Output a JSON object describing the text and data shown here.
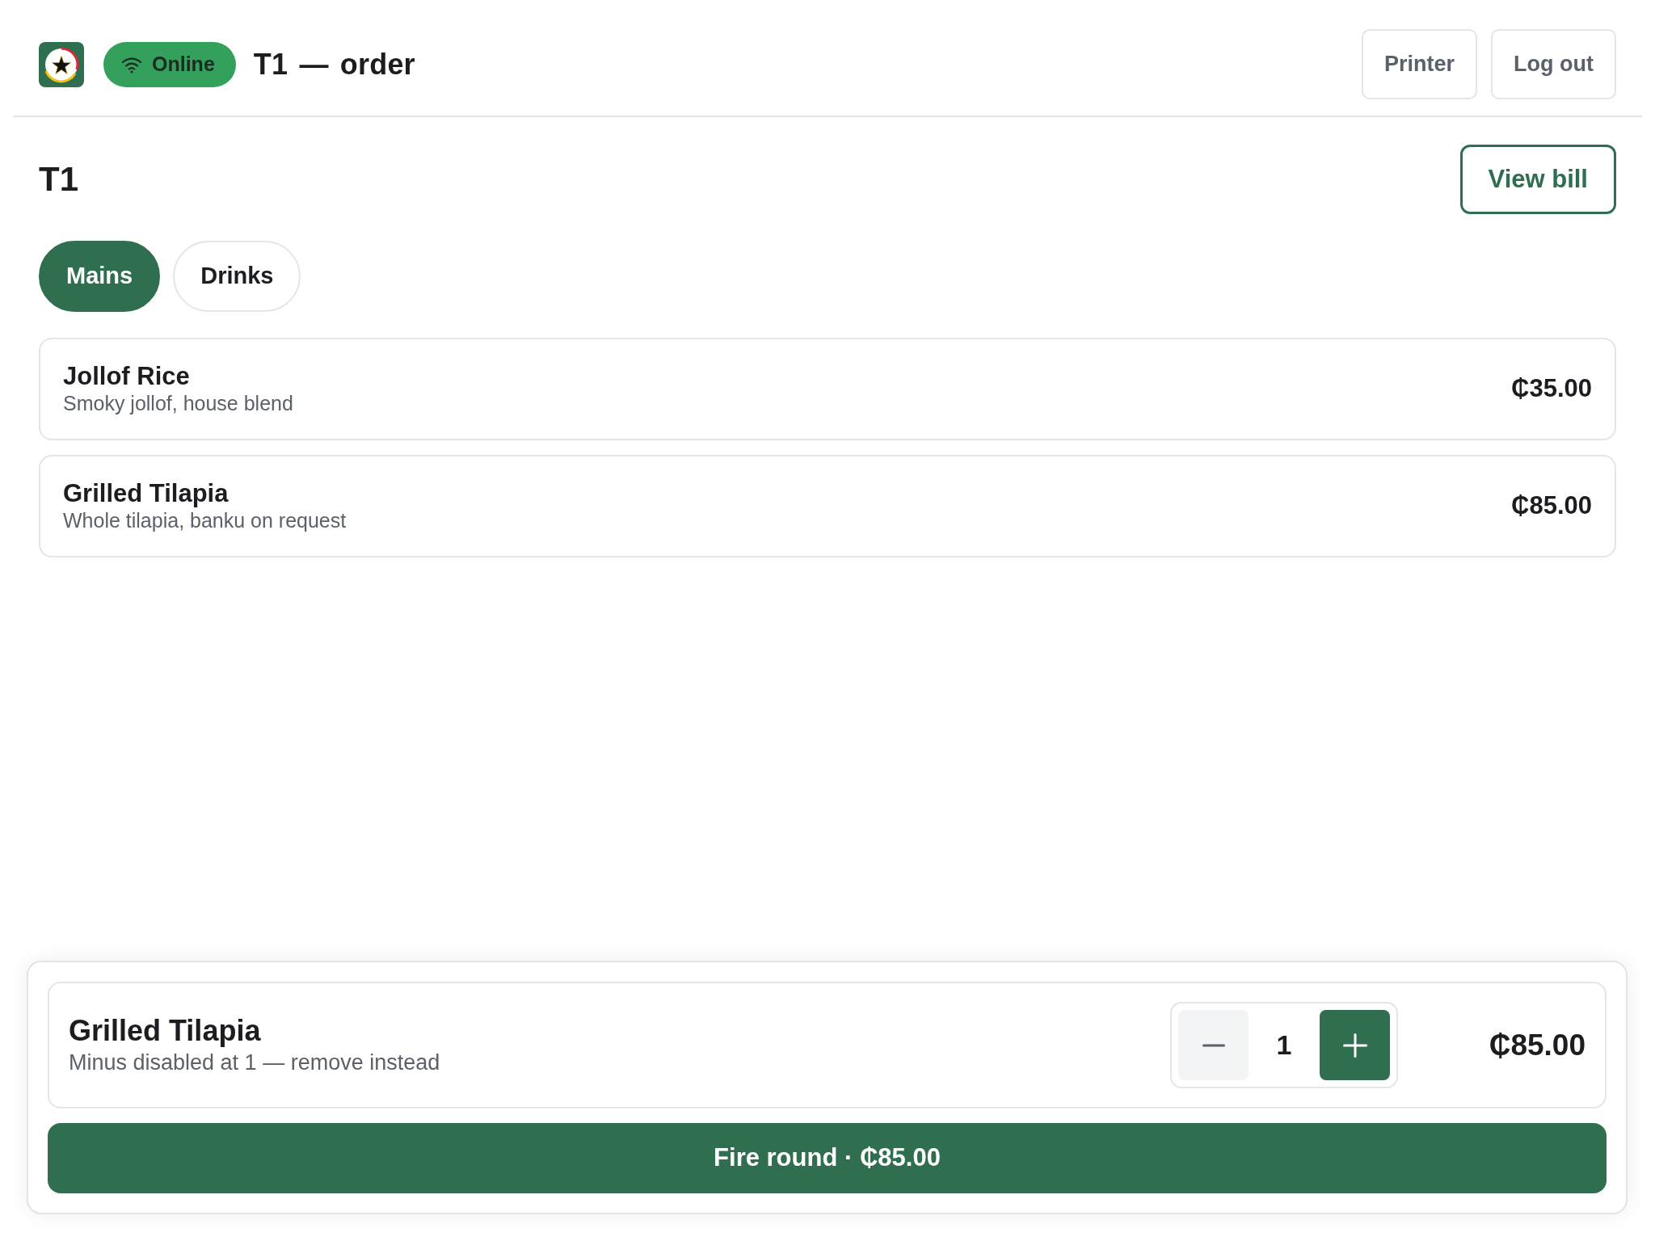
{
  "header": {
    "status": {
      "label": "Online",
      "online": true
    },
    "title": "T1 — order",
    "buttons": [
      "Printer",
      "Log out"
    ]
  },
  "table": {
    "heading": "T1",
    "view_bill_button": "View bill"
  },
  "tabs": [
    {
      "label": "Mains",
      "selected": true
    },
    {
      "label": "Drinks",
      "selected": false
    }
  ],
  "menu_items": [
    {
      "name": "Jollof Rice",
      "description": "Smoky jollof, house blend",
      "price": "₵35.00"
    },
    {
      "name": "Grilled Tilapia",
      "description": "Whole tilapia, banku on request",
      "price": "₵85.00"
    }
  ],
  "order": {
    "lines": [
      {
        "name": "Grilled Tilapia",
        "note": "Minus disabled at 1 — remove instead",
        "quantity": "1",
        "minus_disabled": true,
        "price": "₵85.00"
      }
    ],
    "fire_button": "Fire round · ₵85.00"
  }
}
